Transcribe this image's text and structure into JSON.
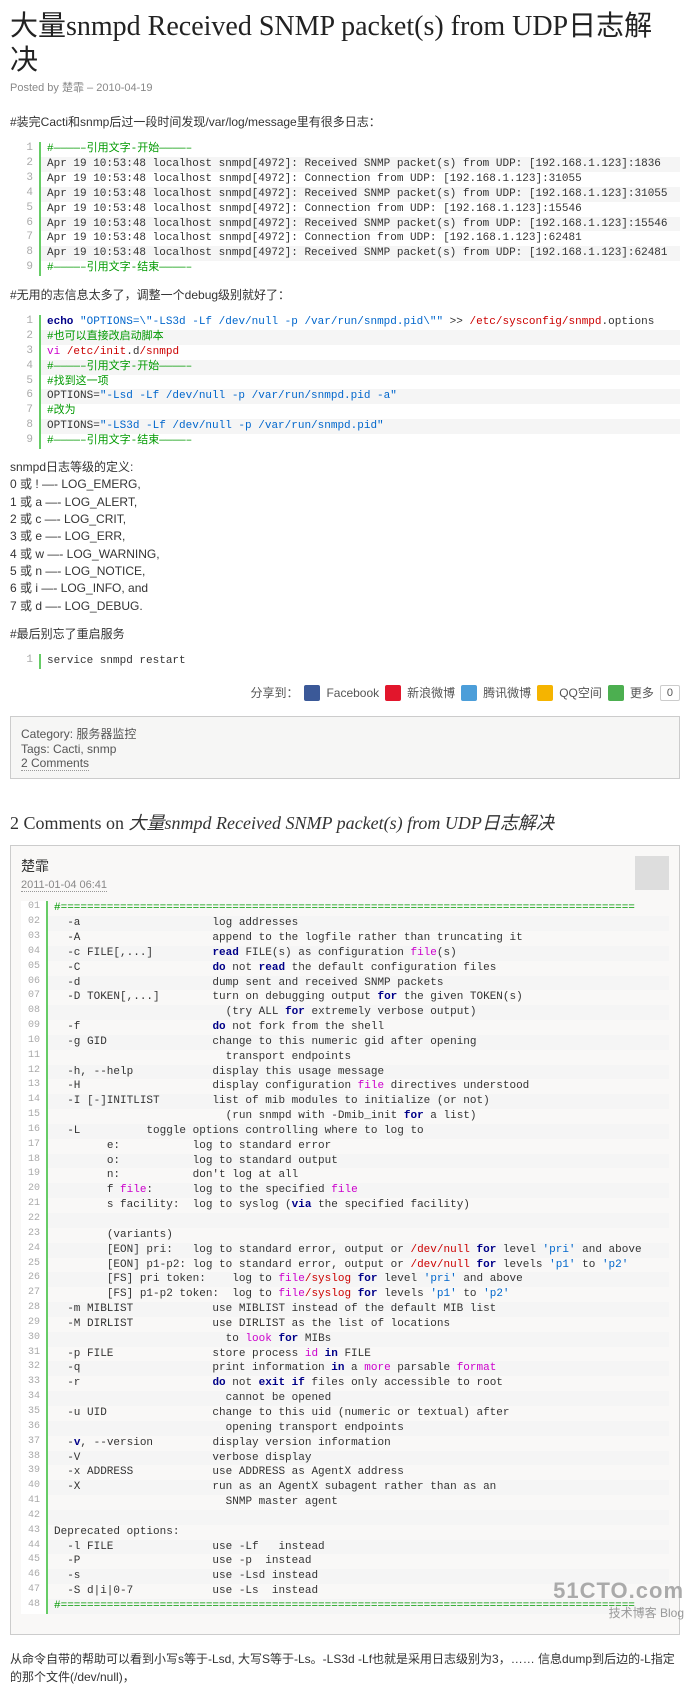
{
  "title": "大量snmpd Received SNMP packet(s) from UDP日志解决",
  "posted_by_label": "Posted by",
  "author": "楚霏",
  "post_date": "2010-04-19",
  "p1": "#装完Cacti和snmp后过一段时间发现/var/log/message里有很多日志：",
  "cb1": [
    [
      {
        "t": "#————–引用文字-开始————–",
        "c": "c-green"
      }
    ],
    [
      {
        "t": "Apr 19 10:53:48 localhost snmpd[4972]: Received SNMP packet(s) from UDP: [192.168.1.123]:1836"
      }
    ],
    [
      {
        "t": "Apr 19 10:53:48 localhost snmpd[4972]: Connection from UDP: [192.168.1.123]:31055"
      }
    ],
    [
      {
        "t": "Apr 19 10:53:48 localhost snmpd[4972]: Received SNMP packet(s) from UDP: [192.168.1.123]:31055"
      }
    ],
    [
      {
        "t": "Apr 19 10:53:48 localhost snmpd[4972]: Connection from UDP: [192.168.1.123]:15546"
      }
    ],
    [
      {
        "t": "Apr 19 10:53:48 localhost snmpd[4972]: Received SNMP packet(s) from UDP: [192.168.1.123]:15546"
      }
    ],
    [
      {
        "t": "Apr 19 10:53:48 localhost snmpd[4972]: Connection from UDP: [192.168.1.123]:62481"
      }
    ],
    [
      {
        "t": "Apr 19 10:53:48 localhost snmpd[4972]: Received SNMP packet(s) from UDP: [192.168.1.123]:62481"
      }
    ],
    [
      {
        "t": "#————–引用文字-结束————–",
        "c": "c-green"
      }
    ]
  ],
  "p2": "#无用的志信息太多了，调整一个debug级别就好了：",
  "cb2": [
    [
      {
        "t": "echo",
        "c": "c-navy"
      },
      {
        "t": " "
      },
      {
        "t": "\"OPTIONS=\\\"-LS3d -Lf /dev/null -p /var/run/snmpd.pid\\\"\"",
        "c": "c-blue"
      },
      {
        "t": " >> "
      },
      {
        "t": "/etc/sysconfig/snmpd",
        "c": "c-red"
      },
      {
        "t": ".options"
      }
    ],
    [
      {
        "t": "#也可以直接改启动脚本",
        "c": "c-green"
      }
    ],
    [
      {
        "t": "vi",
        "c": "c-mag"
      },
      {
        "t": " "
      },
      {
        "t": "/etc/init",
        "c": "c-red"
      },
      {
        "t": ".d"
      },
      {
        "t": "/snmpd",
        "c": "c-red"
      }
    ],
    [
      {
        "t": "#————–引用文字-开始————–",
        "c": "c-green"
      }
    ],
    [
      {
        "t": "#找到这一项",
        "c": "c-green"
      }
    ],
    [
      {
        "t": "OPTIONS="
      },
      {
        "t": "\"-Lsd -Lf /dev/null -p /var/run/snmpd.pid -a\"",
        "c": "c-blue"
      }
    ],
    [
      {
        "t": "#改为",
        "c": "c-green"
      }
    ],
    [
      {
        "t": "OPTIONS="
      },
      {
        "t": "\"-LS3d -Lf /dev/null -p /var/run/snmpd.pid\"",
        "c": "c-blue"
      }
    ],
    [
      {
        "t": "#————–引用文字-结束————–",
        "c": "c-green"
      }
    ]
  ],
  "level_defs": [
    "snmpd日志等级的定义:",
    "0 或 ! —- LOG_EMERG,",
    "1 或 a —- LOG_ALERT,",
    "2 或 c —- LOG_CRIT,",
    "3 或 e —- LOG_ERR,",
    "4 或 w —- LOG_WARNING,",
    "5 或 n —- LOG_NOTICE,",
    "6 或 i —- LOG_INFO, and",
    "7 或 d —- LOG_DEBUG."
  ],
  "p3": "#最后别忘了重启服务",
  "cb3": [
    [
      {
        "t": "service snmpd restart"
      }
    ]
  ],
  "share": {
    "label": "分享到：",
    "facebook": "Facebook",
    "weibo": "新浪微博",
    "tencent": "腾讯微博",
    "qzone": "QQ空间",
    "more": "更多",
    "count": "0"
  },
  "cat": {
    "category_label": "Category:",
    "category": "服务器监控",
    "tags_label": "Tags:",
    "tag1": "Cacti",
    "tag2": "snmp",
    "comments": "2 Comments"
  },
  "comments_heading_prefix": "2 Comments on ",
  "comment1": {
    "author": "楚霏",
    "date": "2011-01-04 06:41"
  },
  "cb4": [
    [
      {
        "t": "#=======================================================================================",
        "c": "c-green"
      }
    ],
    [
      {
        "t": "  -a                    log addresses"
      }
    ],
    [
      {
        "t": "  -A                    append to the logfile rather than truncating it"
      }
    ],
    [
      {
        "t": "  -c FILE[,...]         "
      },
      {
        "t": "read",
        "c": "c-navy"
      },
      {
        "t": " FILE(s) as configuration "
      },
      {
        "t": "file",
        "c": "c-mag"
      },
      {
        "t": "(s)"
      }
    ],
    [
      {
        "t": "  -C                    "
      },
      {
        "t": "do",
        "c": "c-navy"
      },
      {
        "t": " not "
      },
      {
        "t": "read",
        "c": "c-navy"
      },
      {
        "t": " the default configuration files"
      }
    ],
    [
      {
        "t": "  -d                    dump sent and received SNMP packets"
      }
    ],
    [
      {
        "t": "  -D TOKEN[,...]        turn on debugging output "
      },
      {
        "t": "for",
        "c": "c-navy"
      },
      {
        "t": " the given TOKEN(s)"
      }
    ],
    [
      {
        "t": "                          (try ALL "
      },
      {
        "t": "for",
        "c": "c-navy"
      },
      {
        "t": " extremely verbose output)"
      }
    ],
    [
      {
        "t": "  -f                    "
      },
      {
        "t": "do",
        "c": "c-navy"
      },
      {
        "t": " not fork from the shell"
      }
    ],
    [
      {
        "t": "  -g GID                change to this numeric gid after opening"
      }
    ],
    [
      {
        "t": "                          transport endpoints"
      }
    ],
    [
      {
        "t": "  -h, --help            display this usage message"
      }
    ],
    [
      {
        "t": "  -H                    display configuration "
      },
      {
        "t": "file",
        "c": "c-mag"
      },
      {
        "t": " directives understood"
      }
    ],
    [
      {
        "t": "  -I [-]INITLIST        list of mib modules to initialize (or not)"
      }
    ],
    [
      {
        "t": "                          (run snmpd with -Dmib_init "
      },
      {
        "t": "for",
        "c": "c-navy"
      },
      {
        "t": " a list)"
      }
    ],
    [
      {
        "t": "  -L          toggle options controlling where to log to"
      }
    ],
    [
      {
        "t": "        e:           log to standard error"
      }
    ],
    [
      {
        "t": "        o:           log to standard output"
      }
    ],
    [
      {
        "t": "        n:           don't log at all"
      }
    ],
    [
      {
        "t": "        f "
      },
      {
        "t": "file",
        "c": "c-mag"
      },
      {
        "t": ":      log to the specified "
      },
      {
        "t": "file",
        "c": "c-mag"
      }
    ],
    [
      {
        "t": "        s facility:  log to syslog ("
      },
      {
        "t": "via",
        "c": "c-navy"
      },
      {
        "t": " the specified facility)"
      }
    ],
    [
      {
        "t": " "
      }
    ],
    [
      {
        "t": "        (variants)"
      }
    ],
    [
      {
        "t": "        [EON] pri:   log to standard error, output or "
      },
      {
        "t": "/dev/null",
        "c": "c-red"
      },
      {
        "t": " "
      },
      {
        "t": "for",
        "c": "c-navy"
      },
      {
        "t": " level "
      },
      {
        "t": "'pri'",
        "c": "c-blue"
      },
      {
        "t": " and above"
      }
    ],
    [
      {
        "t": "        [EON] p1-p2: log to standard error, output or "
      },
      {
        "t": "/dev/null",
        "c": "c-red"
      },
      {
        "t": " "
      },
      {
        "t": "for",
        "c": "c-navy"
      },
      {
        "t": " levels "
      },
      {
        "t": "'p1'",
        "c": "c-blue"
      },
      {
        "t": " to "
      },
      {
        "t": "'p2'",
        "c": "c-blue"
      }
    ],
    [
      {
        "t": "        [FS] pri token:    log to "
      },
      {
        "t": "file",
        "c": "c-mag"
      },
      {
        "t": "/syslog",
        "c": "c-red"
      },
      {
        "t": " "
      },
      {
        "t": "for",
        "c": "c-navy"
      },
      {
        "t": " level "
      },
      {
        "t": "'pri'",
        "c": "c-blue"
      },
      {
        "t": " and above"
      }
    ],
    [
      {
        "t": "        [FS] p1-p2 token:  log to "
      },
      {
        "t": "file",
        "c": "c-mag"
      },
      {
        "t": "/syslog",
        "c": "c-red"
      },
      {
        "t": " "
      },
      {
        "t": "for",
        "c": "c-navy"
      },
      {
        "t": " levels "
      },
      {
        "t": "'p1'",
        "c": "c-blue"
      },
      {
        "t": " to "
      },
      {
        "t": "'p2'",
        "c": "c-blue"
      }
    ],
    [
      {
        "t": "  -m MIBLIST            use MIBLIST instead of the default MIB list"
      }
    ],
    [
      {
        "t": "  -M DIRLIST            use DIRLIST as the list of locations"
      }
    ],
    [
      {
        "t": "                          to "
      },
      {
        "t": "look",
        "c": "c-mag"
      },
      {
        "t": " "
      },
      {
        "t": "for",
        "c": "c-navy"
      },
      {
        "t": " MIBs"
      }
    ],
    [
      {
        "t": "  -p FILE               store process "
      },
      {
        "t": "id",
        "c": "c-mag"
      },
      {
        "t": " "
      },
      {
        "t": "in",
        "c": "c-navy"
      },
      {
        "t": " FILE"
      }
    ],
    [
      {
        "t": "  -q                    print information "
      },
      {
        "t": "in",
        "c": "c-navy"
      },
      {
        "t": " a "
      },
      {
        "t": "more",
        "c": "c-mag"
      },
      {
        "t": " parsable "
      },
      {
        "t": "format",
        "c": "c-mag"
      }
    ],
    [
      {
        "t": "  -r                    "
      },
      {
        "t": "do",
        "c": "c-navy"
      },
      {
        "t": " not "
      },
      {
        "t": "exit",
        "c": "c-navy"
      },
      {
        "t": " "
      },
      {
        "t": "if",
        "c": "c-navy"
      },
      {
        "t": " files only accessible to root"
      }
    ],
    [
      {
        "t": "                          cannot be opened"
      }
    ],
    [
      {
        "t": "  -u UID                change to this uid (numeric or textual) after"
      }
    ],
    [
      {
        "t": "                          opening transport endpoints"
      }
    ],
    [
      {
        "t": "  -"
      },
      {
        "t": "v",
        "c": "c-navy"
      },
      {
        "t": ", --version         display version information"
      }
    ],
    [
      {
        "t": "  -V                    verbose display"
      }
    ],
    [
      {
        "t": "  -x ADDRESS            use ADDRESS as AgentX address"
      }
    ],
    [
      {
        "t": "  -X                    run as an AgentX subagent rather than as an"
      }
    ],
    [
      {
        "t": "                          SNMP master agent"
      }
    ],
    [
      {
        "t": " "
      }
    ],
    [
      {
        "t": "Deprecated options:"
      }
    ],
    [
      {
        "t": "  -l FILE               use -Lf   instead"
      }
    ],
    [
      {
        "t": "  -P                    use -p  instead"
      }
    ],
    [
      {
        "t": "  -s                    use -Lsd instead"
      }
    ],
    [
      {
        "t": "  -S d|i|0-7            use -Ls  instead"
      }
    ],
    [
      {
        "t": "#=======================================================================================",
        "c": "c-green"
      }
    ]
  ],
  "closing": "从命令自带的帮助可以看到小写s等于-Lsd, 大写S等于-Ls。-LS3d -Lf也就是采用日志级别为3，…… 信息dump到后边的-L指定的那个文件(/dev/null)，",
  "watermark": {
    "big": "51CTO.com",
    "small": "技术博客  Blog"
  }
}
